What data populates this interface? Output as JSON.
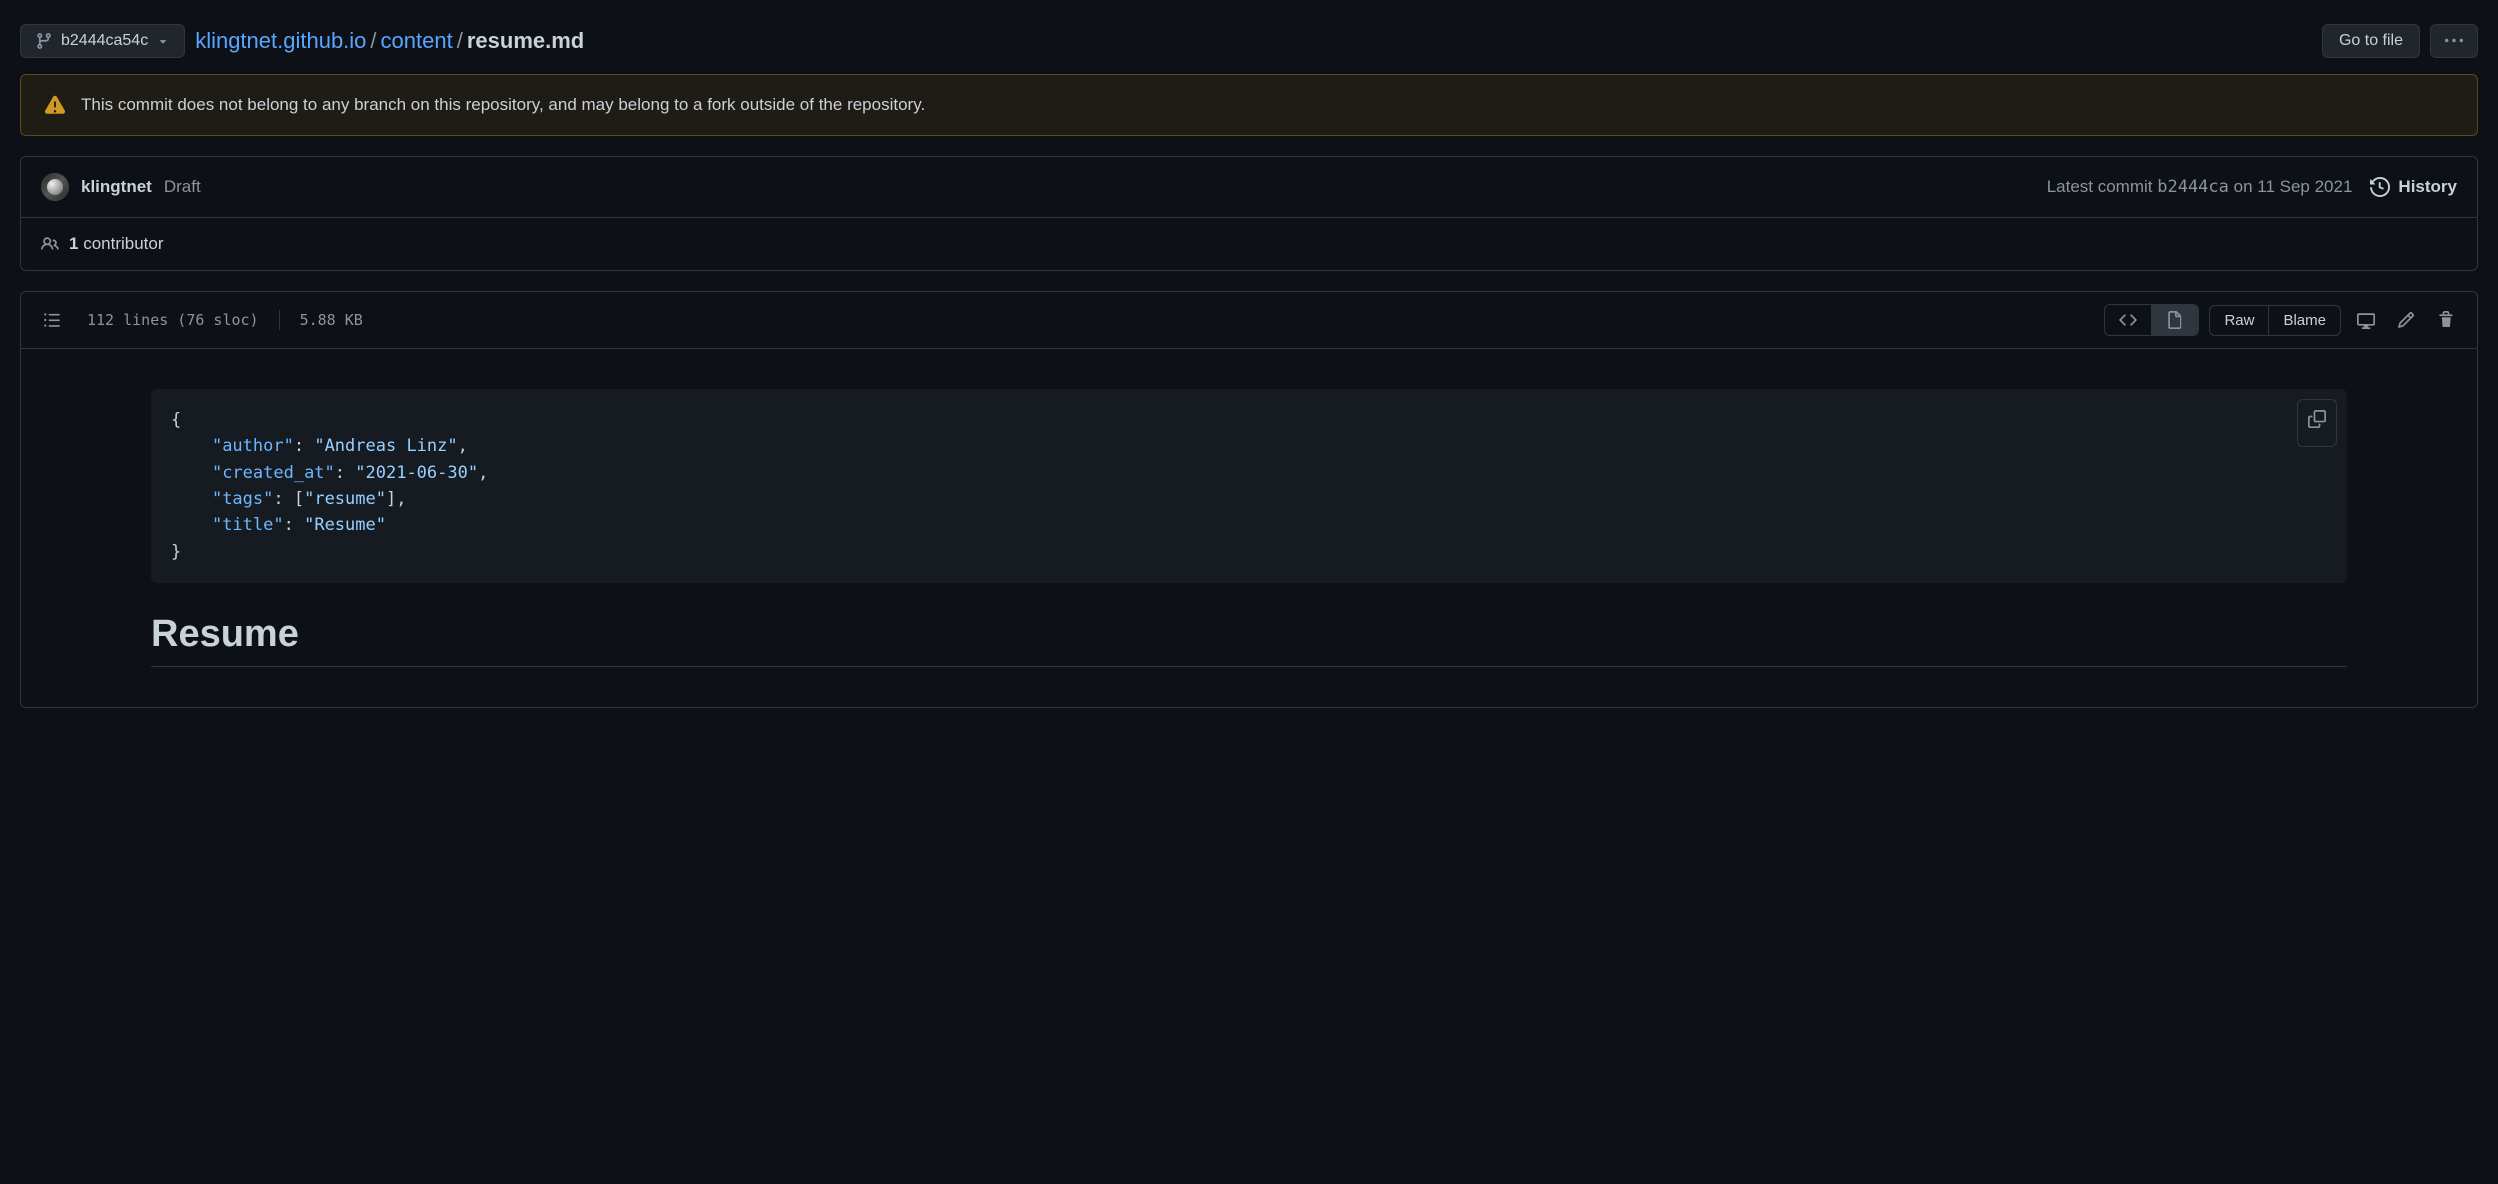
{
  "branch": {
    "ref": "b2444ca54c"
  },
  "breadcrumb": {
    "repo": "klingtnet.github.io",
    "dir": "content",
    "file": "resume.md"
  },
  "actions": {
    "go_to_file": "Go to file"
  },
  "warning": {
    "text": "This commit does not belong to any branch on this repository, and may belong to a fork outside of the repository."
  },
  "commit": {
    "author": "klingtnet",
    "message": "Draft",
    "latest_label": "Latest commit",
    "hash": "b2444ca",
    "date": "on 11 Sep 2021",
    "history_label": "History"
  },
  "contributors": {
    "count": "1",
    "label": "contributor"
  },
  "file_stats": {
    "lines": "112 lines (76 sloc)",
    "size": "5.88 KB"
  },
  "view_modes": {
    "raw": "Raw",
    "blame": "Blame"
  },
  "frontmatter": {
    "l1": "{",
    "l2_k": "\"author\"",
    "l2_v": "\"Andreas Linz\"",
    "l3_k": "\"created_at\"",
    "l3_v": "\"2021-06-30\"",
    "l4_k": "\"tags\"",
    "l4_v": "\"resume\"",
    "l5_k": "\"title\"",
    "l5_v": "\"Resume\"",
    "l6": "}"
  },
  "content": {
    "heading": "Resume"
  }
}
